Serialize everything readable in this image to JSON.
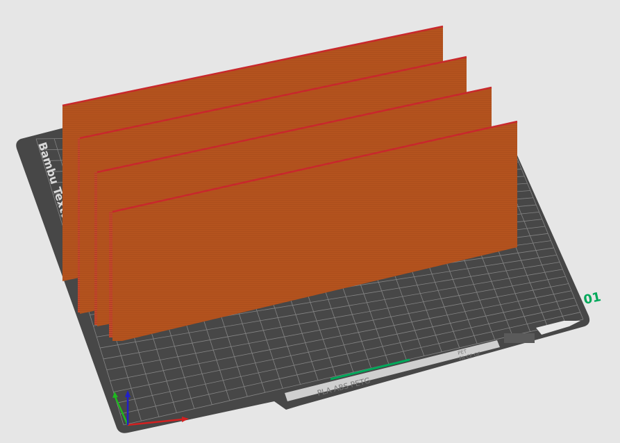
{
  "viewport": {
    "plate": {
      "brand_label": "Bambu Textured PEI Plate",
      "plate_number": "01",
      "footer_label": "PLA ABS PETG",
      "footer_right_label": "PET",
      "footer_right_sublabel": "PA CF GF",
      "plate_color": "#474747",
      "grid_color": "#9a9a9a",
      "number_color": "#00a85a"
    },
    "model": {
      "wall_count": 4,
      "color": "#b4531e",
      "edge_color": "#c8282c"
    },
    "axes": {
      "x_color": "#d42020",
      "y_color": "#1fb81f",
      "z_color": "#2020c8"
    }
  }
}
